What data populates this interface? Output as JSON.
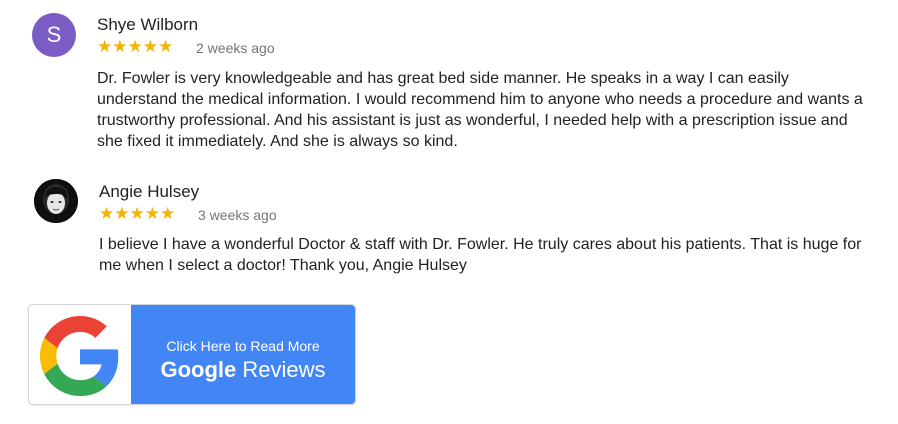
{
  "reviews": [
    {
      "avatar_letter": "S",
      "avatar_color": "#7b5cc4",
      "name": "Shye Wilborn",
      "stars": "★★★★★",
      "rating": 5,
      "date": "2 weeks ago",
      "text": "Dr. Fowler is very knowledgeable and has great bed side manner. He speaks in a way I can easily understand the medical information. I would recommend him to anyone who needs a procedure and wants a trustworthy professional. And his assistant is just as wonderful, I needed help with a prescription issue and she fixed it immediately. And she is always so kind."
    },
    {
      "avatar_letter": "",
      "name": "Angie Hulsey",
      "stars": "★★★★★",
      "rating": 5,
      "date": "3 weeks ago",
      "text": "I believe I have a wonderful Doctor & staff with Dr. Fowler. He truly cares about his patients. That is huge for me when I select a doctor! Thank you, Angie Hulsey"
    }
  ],
  "google_button": {
    "line1": "Click Here to Read More",
    "brand": "Google",
    "word": "Reviews",
    "button_color": "#4285f4",
    "star_color": "#f5b400"
  }
}
